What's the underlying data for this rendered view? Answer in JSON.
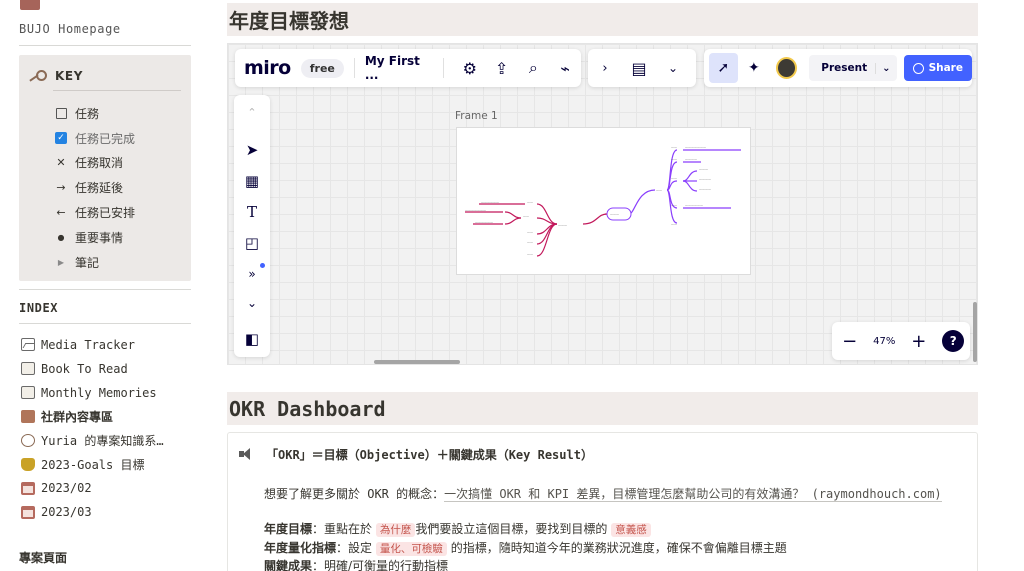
{
  "sidebar": {
    "home_link": "BUJO Homepage",
    "key": {
      "title": "KEY",
      "items": [
        {
          "symbol": "",
          "label": "任務"
        },
        {
          "symbol": "✓",
          "label": "任務已完成"
        },
        {
          "symbol": "✕",
          "label": "任務取消"
        },
        {
          "symbol": "→",
          "label": "任務延後"
        },
        {
          "symbol": "←",
          "label": "任務已安排"
        },
        {
          "symbol": "●",
          "label": "重要事情"
        },
        {
          "symbol": "▶",
          "label": "筆記"
        }
      ]
    },
    "index": {
      "title": "INDEX",
      "items": [
        {
          "icon": "chart-icon",
          "label": "Media Tracker"
        },
        {
          "icon": "image-icon",
          "label": "Book To Read"
        },
        {
          "icon": "image-icon",
          "label": "Monthly Memories"
        },
        {
          "icon": "box-icon",
          "label": "社群內容專區"
        },
        {
          "icon": "pin-icon",
          "label": "Yuria 的專案知識系…"
        },
        {
          "icon": "trophy-icon",
          "label": "2023-Goals 目標"
        },
        {
          "icon": "calendar-icon",
          "label": "2023/02"
        },
        {
          "icon": "calendar-icon",
          "label": "2023/03"
        }
      ]
    },
    "projects_title": "專案頁面"
  },
  "sections": {
    "goals_heading": "年度目標發想",
    "okr_heading": "OKR Dashboard"
  },
  "miro": {
    "logo": "miro",
    "plan": "free",
    "board_name": "My First ...",
    "present_label": "Present",
    "share_label": "Share",
    "frame_label": "Frame 1",
    "zoom": "47%",
    "help": "?",
    "colors": {
      "accent": "#4262ff",
      "mindmap_purple": "#8a3ffc",
      "mindmap_pink": "#c2185b"
    }
  },
  "callout": {
    "title": "「OKR」＝目標（Objective）＋關鍵成果（Key Result）",
    "intro_prefix": "想要了解更多關於 OKR 的概念：",
    "intro_link": "一次搞懂 OKR 和 KPI 差異，目標管理怎麼幫助公司的有效溝通？ (raymondhouch.com)",
    "line1": {
      "label": "年度目標",
      "pre": "：重點在於",
      "tag1": "為什麼",
      "mid": "我們要設立這個目標，要找到目標的",
      "tag2": "意義感"
    },
    "line2": {
      "label": "年度量化指標",
      "pre": "：設定",
      "tag1": "量化、可檢驗",
      "post": "的指標，隨時知道今年的業務狀況進度，確保不會偏離目標主題"
    },
    "line3": {
      "label": "關鍵成果",
      "post": "：明確/可衡量的行動指標"
    }
  }
}
